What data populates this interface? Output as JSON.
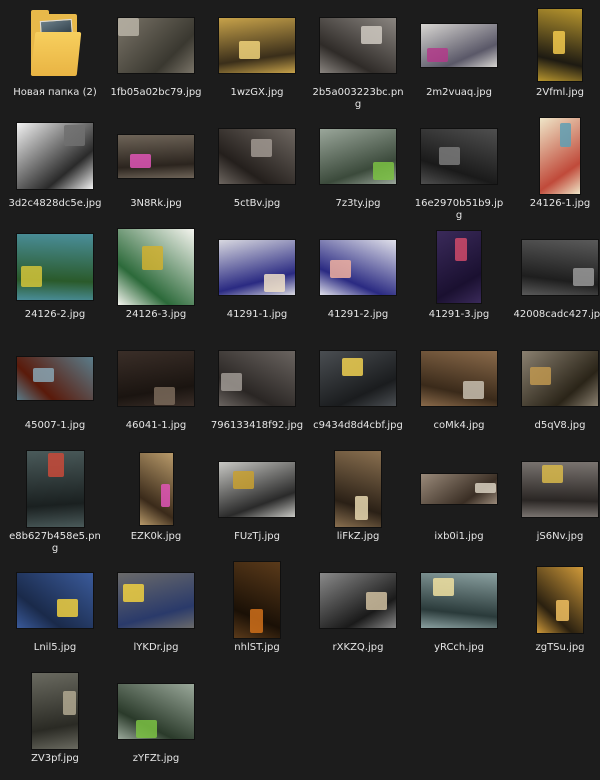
{
  "folder": {
    "label": "Новая папка (2)",
    "icon": "folder-icon"
  },
  "files": [
    {
      "label": "1fb05a02bc79.jpg",
      "w": 76,
      "h": 55,
      "c1": "#7a7468",
      "c2": "#3a3830",
      "c3": "#b9b3a6"
    },
    {
      "label": "1wzGX.jpg",
      "w": 76,
      "h": 55,
      "c1": "#c7a24a",
      "c2": "#3a2e1a",
      "c3": "#f0d27a"
    },
    {
      "label": "2b5a003223bc.png",
      "w": 76,
      "h": 55,
      "c1": "#8a8580",
      "c2": "#2f2b28",
      "c3": "#cfc9c1"
    },
    {
      "label": "2m2vuaq.jpg",
      "w": 76,
      "h": 43,
      "c1": "#d8d6d2",
      "c2": "#5a5868",
      "c3": "#b23a8a"
    },
    {
      "label": "2Vfml.jpg",
      "w": 44,
      "h": 72,
      "c1": "#b8962e",
      "c2": "#1d1a12",
      "c3": "#f2c94c"
    },
    {
      "label": "3d2c4828dc5e.jpg",
      "w": 76,
      "h": 66,
      "c1": "#f2f2f2",
      "c2": "#2a2a2a",
      "c3": "#707070"
    },
    {
      "label": "3N8Rk.jpg",
      "w": 76,
      "h": 43,
      "c1": "#6e6458",
      "c2": "#2b241e",
      "c3": "#e055b6"
    },
    {
      "label": "5ctBv.jpg",
      "w": 76,
      "h": 55,
      "c1": "#6d6660",
      "c2": "#241f1c",
      "c3": "#a09890"
    },
    {
      "label": "7z3ty.jpg",
      "w": 76,
      "h": 55,
      "c1": "#9aa69a",
      "c2": "#3b4a3b",
      "c3": "#7bc243"
    },
    {
      "label": "16e2970b51b9.jpg",
      "w": 76,
      "h": 55,
      "c1": "#4f4f4f",
      "c2": "#1a1a1a",
      "c3": "#7a7a7a"
    },
    {
      "label": "24126-1.jpg",
      "w": 40,
      "h": 76,
      "c1": "#efe6c8",
      "c2": "#c04a3a",
      "c3": "#5e9fb4"
    },
    {
      "label": "24126-2.jpg",
      "w": 76,
      "h": 66,
      "c1": "#4a8e9a",
      "c2": "#2a5a2a",
      "c3": "#d4c43a"
    },
    {
      "label": "24126-3.jpg",
      "w": 76,
      "h": 76,
      "c1": "#f4f4ee",
      "c2": "#2c6a3a",
      "c3": "#d0b030"
    },
    {
      "label": "41291-1.jpg",
      "w": 76,
      "h": 55,
      "c1": "#d8d8e0",
      "c2": "#2a2a82",
      "c3": "#f0e0c8"
    },
    {
      "label": "41291-2.jpg",
      "w": 76,
      "h": 55,
      "c1": "#e0e0ea",
      "c2": "#2a2a82",
      "c3": "#f0b0a0"
    },
    {
      "label": "41291-3.jpg",
      "w": 44,
      "h": 72,
      "c1": "#3a2a5a",
      "c2": "#1a1030",
      "c3": "#d04a6a"
    },
    {
      "label": "42008cadc427.jpg",
      "w": 76,
      "h": 55,
      "c1": "#5a5a5a",
      "c2": "#1e1e1e",
      "c3": "#9a9a9a"
    },
    {
      "label": "45007-1.jpg",
      "w": 76,
      "h": 43,
      "c1": "#5a7c8a",
      "c2": "#5a1a0a",
      "c3": "#8aa6b4"
    },
    {
      "label": "46041-1.jpg",
      "w": 76,
      "h": 55,
      "c1": "#3a2e28",
      "c2": "#1a1410",
      "c3": "#7a6a5a"
    },
    {
      "label": "796133418f92.jpg",
      "w": 76,
      "h": 55,
      "c1": "#6a6460",
      "c2": "#2a2624",
      "c3": "#a09a94"
    },
    {
      "label": "c9434d8d4cbf.jpg",
      "w": 76,
      "h": 55,
      "c1": "#4a4e52",
      "c2": "#1a1c1e",
      "c3": "#f0d050"
    },
    {
      "label": "coMk4.jpg",
      "w": 76,
      "h": 55,
      "c1": "#8a6a4a",
      "c2": "#3a2a1a",
      "c3": "#c8c0b0"
    },
    {
      "label": "d5qV8.jpg",
      "w": 76,
      "h": 55,
      "c1": "#8a8070",
      "c2": "#2a2418",
      "c3": "#c09850"
    },
    {
      "label": "e8b627b458e5.png",
      "w": 57,
      "h": 76,
      "c1": "#4a5a5a",
      "c2": "#1a2020",
      "c3": "#c84a3a"
    },
    {
      "label": "EZK0k.jpg",
      "w": 33,
      "h": 72,
      "c1": "#b89a6a",
      "c2": "#3a2a1a",
      "c3": "#e055b6"
    },
    {
      "label": "FUzTj.jpg",
      "w": 76,
      "h": 55,
      "c1": "#c8c8c4",
      "c2": "#2a2a2a",
      "c3": "#c8a030"
    },
    {
      "label": "liFkZ.jpg",
      "w": 46,
      "h": 76,
      "c1": "#8a7050",
      "c2": "#2a2016",
      "c3": "#e8d8b0"
    },
    {
      "label": "ixb0i1.jpg",
      "w": 76,
      "h": 30,
      "c1": "#9a8a7a",
      "c2": "#3a2e24",
      "c3": "#d8d0c0"
    },
    {
      "label": "jS6Nv.jpg",
      "w": 76,
      "h": 55,
      "c1": "#7a7470",
      "c2": "#2a2624",
      "c3": "#d8b84a"
    },
    {
      "label": "Lnil5.jpg",
      "w": 76,
      "h": 55,
      "c1": "#3a5a9a",
      "c2": "#1a2a4a",
      "c3": "#f0d040"
    },
    {
      "label": "lYKDr.jpg",
      "w": 76,
      "h": 55,
      "c1": "#6a6a6a",
      "c2": "#2a3a6a",
      "c3": "#f0d040"
    },
    {
      "label": "nhlST.jpg",
      "w": 46,
      "h": 76,
      "c1": "#5a3a1a",
      "c2": "#1a1006",
      "c3": "#d0701a"
    },
    {
      "label": "rXKZQ.jpg",
      "w": 76,
      "h": 55,
      "c1": "#8a8a8a",
      "c2": "#1a1a1a",
      "c3": "#d0c0a0"
    },
    {
      "label": "yRCch.jpg",
      "w": 76,
      "h": 55,
      "c1": "#8aa0a0",
      "c2": "#2a3a3a",
      "c3": "#f0e0a0"
    },
    {
      "label": "zgTSu.jpg",
      "w": 46,
      "h": 66,
      "c1": "#d09a3a",
      "c2": "#2a2010",
      "c3": "#f0c060"
    },
    {
      "label": "ZV3pf.jpg",
      "w": 46,
      "h": 76,
      "c1": "#6a6a60",
      "c2": "#2a2a24",
      "c3": "#b0a890"
    },
    {
      "label": "zYFZt.jpg",
      "w": 76,
      "h": 55,
      "c1": "#9aa89a",
      "c2": "#2a3a2a",
      "c3": "#7bc243"
    }
  ]
}
